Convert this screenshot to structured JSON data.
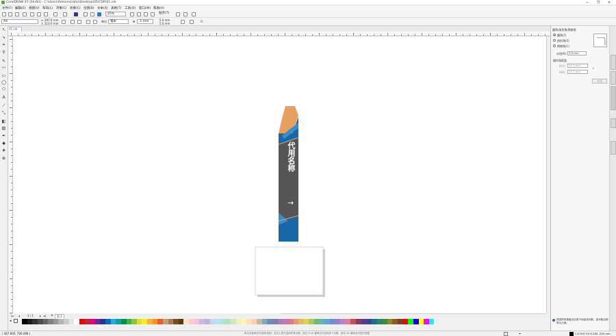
{
  "window": {
    "title": "CorelDRAW X7 (64-Bit) - C:\\Users\\Administrator\\Desktop\\05\\CDR\\01.cdr",
    "controls": [
      "—",
      "❐",
      "✕"
    ]
  },
  "menu": {
    "items": [
      "文件(F)",
      "编辑(E)",
      "视图(V)",
      "布局(L)",
      "对象(C)",
      "效果(C)",
      "位图(B)",
      "文本(X)",
      "表格(T)",
      "工具(O)",
      "窗口(W)",
      "帮助(H)"
    ]
  },
  "toolbar": {
    "zoom_value": "25%",
    "snap_label": "贴齐(T)"
  },
  "propbar": {
    "page_size": "A4",
    "width": "297.0 mm",
    "height": "210.0 mm",
    "units_label": "单位:",
    "units_value": "毫米",
    "nudge": ".1 mm",
    "dup_x": "5.0 mm",
    "dup_y": "5.0 mm"
  },
  "document": {
    "tab_label": "01.cdr"
  },
  "artwork": {
    "vertical_text": "代用名称",
    "arrow": "→",
    "colors": {
      "orange": "#E8A060",
      "blue": "#1868A8",
      "dark": "#555555",
      "lightblue": "#2F8FD0"
    }
  },
  "pagenav": {
    "page_count": "1 / 1",
    "page_tab": "页 1"
  },
  "status": {
    "coordinates": "( 467.600, 700.098 )",
    "hint": "单击对象两次可旋转/倾斜；双击工具可选择所有对象；按住 Shift 键单击可选择多个对象；按住 Alt 键单击可进行挖掘",
    "fill_info": "C:0 M:0 Y:0 K:100 .200 mm"
  },
  "docker": {
    "title": "圆角/扇形角/倒棱角",
    "options": [
      "圆角(F)",
      "扇形角(S)",
      "倒棱角(C)"
    ],
    "radius_label": "半径(R):",
    "radius_value": "3.0 mm",
    "corner_section": "操作角距离",
    "corner_a_label": "B(A):",
    "corner_a_value": "12.7 mm",
    "corner_b_label": "B(B):",
    "corner_b_value": "12.7 mm",
    "apply_label": "应用",
    "help_text": "请选择将角度点应用于待曲线对象，该对象由钢笔为凸角。"
  },
  "palette": {
    "colors": [
      "#000000",
      "#1a1a1a",
      "#333333",
      "#4d4d4d",
      "#666666",
      "#808080",
      "#999999",
      "#b3b3b3",
      "#cccccc",
      "#e6e6e6",
      "#ffffff",
      "#e30613",
      "#c1272d",
      "#e5007e",
      "#662d91",
      "#2e3192",
      "#0071bc",
      "#29abe2",
      "#00a99d",
      "#009245",
      "#39b54a",
      "#8cc63f",
      "#d9e021",
      "#fcee21",
      "#fbb03b",
      "#f7931e",
      "#f15a24",
      "#c69c6d",
      "#a67c52",
      "#754c24",
      "#603813",
      "#ffe6cc",
      "#ffcccc",
      "#f2c4de",
      "#d4b5dc",
      "#b9b7db",
      "#bcd9f0",
      "#b7e3f3",
      "#b2e0dc",
      "#b8dfc0",
      "#d3e8b9",
      "#eef2b7",
      "#fff6b8",
      "#fde2b3",
      "#fbd1b6",
      "#c8b6a5",
      "#7aa8c7",
      "#6d8fb0",
      "#7d7fb3",
      "#a37db5",
      "#c77ab0",
      "#e07a8a",
      "#e69a6e",
      "#e3bb5e",
      "#d9d45c",
      "#a8c95c",
      "#6dbb7e",
      "#5fb8b0",
      "#5ea7d3",
      "#6f8fd1",
      "#9a7fd1",
      "#c47fc9",
      "#d97fa5",
      "#c44d58",
      "#8b3a62",
      "#5b3a8b",
      "#2f4b8b",
      "#1f6f8b",
      "#1f8b6f",
      "#3a8b3a",
      "#8b8b1f",
      "#8b5b1f",
      "#8b3a1f",
      "#ff0000",
      "#00ff00",
      "#0000ff",
      "#ffff00",
      "#ff00ff",
      "#00ffff"
    ]
  }
}
